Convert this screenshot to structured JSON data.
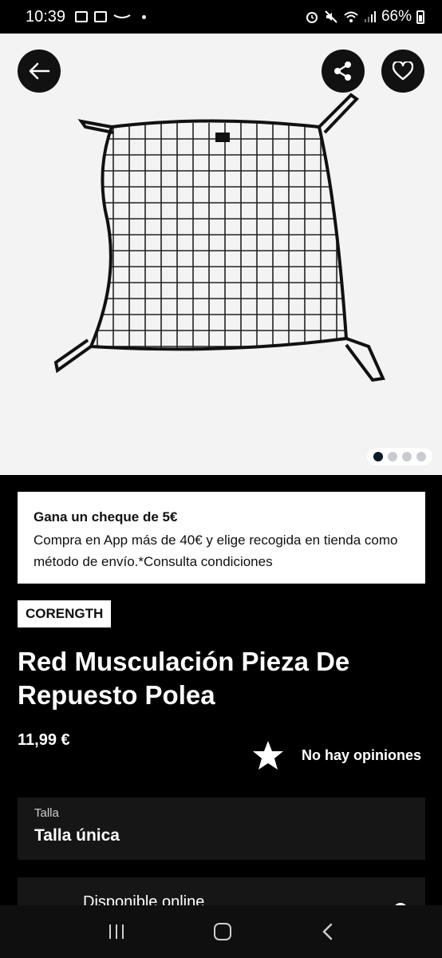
{
  "status_bar": {
    "time": "10:39",
    "battery": "66%"
  },
  "gallery": {
    "page_count": 4,
    "current_page": 1
  },
  "promo": {
    "title": "Gana un cheque de 5€",
    "text": "Compra en App más de 40€ y elige recogida en tienda como método de envío.*Consulta condiciones"
  },
  "product": {
    "brand": "CORENGTH",
    "title": "Red Musculación Pieza De Repuesto Polea",
    "price": "11,99 €",
    "rating_text": "No hay opiniones"
  },
  "size": {
    "label": "Talla",
    "value": "Talla única"
  },
  "availability": {
    "label": "Disponible online"
  },
  "colors": {
    "background": "#000000",
    "gallery_bg": "#f3f3f3",
    "button_bg": "#111111",
    "panel_bg": "#161616",
    "pager_active": "#0a1a2b"
  },
  "icons": [
    "back-arrow-icon",
    "share-icon",
    "heart-icon",
    "star-icon"
  ]
}
